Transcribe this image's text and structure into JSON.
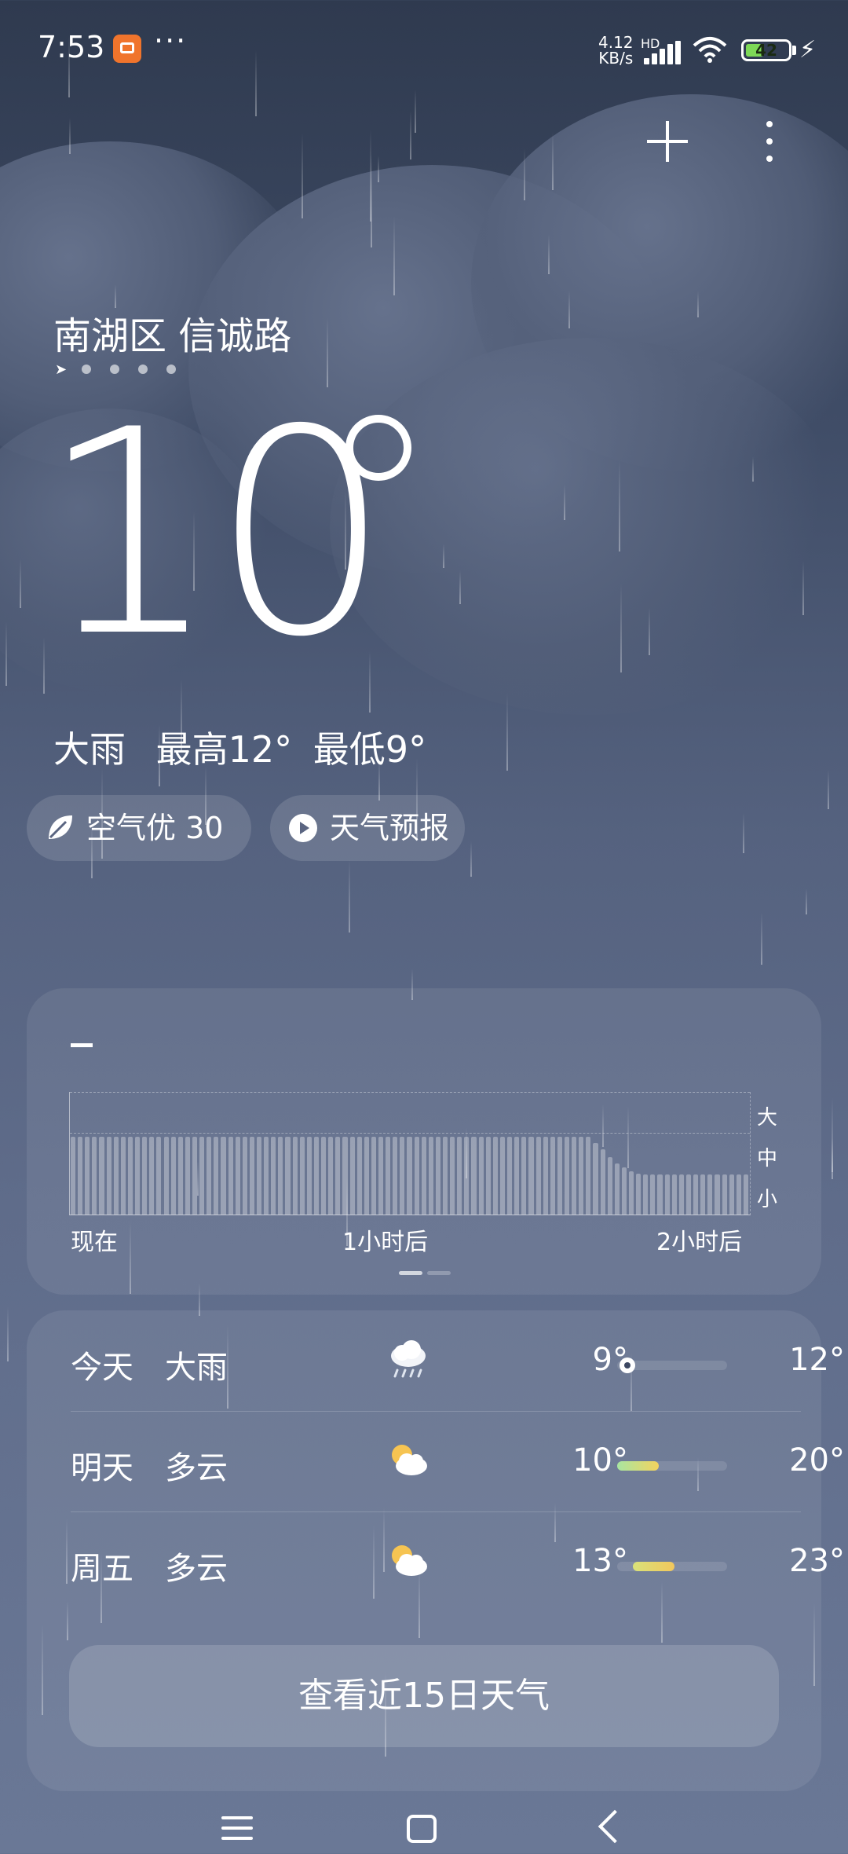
{
  "status_bar": {
    "time": "7:53",
    "more": "···",
    "network_speed_value": "4.12",
    "network_speed_unit": "KB/s",
    "network_type": "HD",
    "battery_level": "42",
    "battery_fraction": 0.42,
    "battery_color": "#7ed957"
  },
  "location": {
    "name": "南湖区 信诚路",
    "page_count": 5,
    "current_page": 1
  },
  "current": {
    "temperature": "10",
    "condition": "大雨",
    "high_label": "最高12°",
    "low_label": "最低9°"
  },
  "pills": {
    "air_label": "空气优 30",
    "forecast_label": "天气预报"
  },
  "rain_chart": {
    "title": "",
    "levels": [
      "大",
      "中",
      "小"
    ],
    "x_labels": [
      "现在",
      "1小时后",
      "2小时后"
    ],
    "pager_active": 0,
    "pager_count": 2
  },
  "chart_data": {
    "type": "bar",
    "title": "",
    "x_start": "现在",
    "x_mid": "1小时后",
    "x_end": "2小时后",
    "y_levels": [
      "小",
      "中",
      "大"
    ],
    "ylim": [
      0,
      3
    ],
    "values": [
      1.9,
      1.9,
      1.9,
      1.9,
      1.9,
      1.9,
      1.9,
      1.9,
      1.9,
      1.9,
      1.9,
      1.9,
      1.9,
      1.9,
      1.9,
      1.9,
      1.9,
      1.9,
      1.9,
      1.9,
      1.9,
      1.9,
      1.9,
      1.9,
      1.9,
      1.9,
      1.9,
      1.9,
      1.9,
      1.9,
      1.9,
      1.9,
      1.9,
      1.9,
      1.9,
      1.9,
      1.9,
      1.9,
      1.9,
      1.9,
      1.9,
      1.9,
      1.9,
      1.9,
      1.9,
      1.9,
      1.9,
      1.9,
      1.9,
      1.9,
      1.9,
      1.9,
      1.9,
      1.9,
      1.9,
      1.9,
      1.9,
      1.9,
      1.9,
      1.9,
      1.9,
      1.9,
      1.9,
      1.9,
      1.9,
      1.9,
      1.9,
      1.9,
      1.9,
      1.9,
      1.9,
      1.9,
      1.9,
      1.75,
      1.6,
      1.4,
      1.25,
      1.15,
      1.05,
      1.0,
      0.98,
      0.98,
      0.98,
      0.98,
      0.98,
      0.98,
      0.98,
      0.98,
      0.98,
      0.98,
      0.98,
      0.98,
      0.98,
      0.98,
      0.98
    ]
  },
  "forecast": {
    "days": [
      {
        "day": "今天",
        "condition": "大雨",
        "icon": "heavy-rain-icon",
        "low": "9°",
        "high": "12°",
        "range": [
          0.0,
          0.0
        ],
        "now_marker": 0.05,
        "color_from": "#ffffff",
        "color_to": "#ffffff"
      },
      {
        "day": "明天",
        "condition": "多云",
        "icon": "partly-cloudy-icon",
        "low": "10°",
        "high": "20°",
        "range": [
          0.0,
          0.38
        ],
        "color_from": "#a8e6a1",
        "color_to": "#f4d35e"
      },
      {
        "day": "周五",
        "condition": "多云",
        "icon": "partly-cloudy-icon",
        "low": "13°",
        "high": "23°",
        "range": [
          0.14,
          0.52
        ],
        "color_from": "#d9e27a",
        "color_to": "#f2c75c"
      }
    ],
    "cta_label": "查看近15日天气"
  }
}
